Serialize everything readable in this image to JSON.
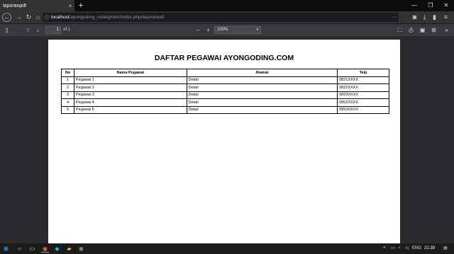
{
  "browser": {
    "tab_title": "laporanpdf",
    "tab_close": "×",
    "new_tab": "+",
    "window_controls": {
      "minimize": "—",
      "restore": "❐",
      "close": "✕"
    },
    "nav": {
      "back": "←",
      "forward": "→",
      "reload": "↻",
      "home": "⌂"
    },
    "url_host": "localhost",
    "url_path": "/ayongoding_codeigniter/index.php/laporanpdf",
    "url_info_icon": "ⓘ",
    "url_more": "···",
    "toolbar_right": {
      "pocket": "◙",
      "downloads": "⤓",
      "library": "▮",
      "menu": "≡"
    }
  },
  "pdf_toolbar": {
    "sidebar_icon": "▯",
    "prev_icon": "↑",
    "next_icon": "↓",
    "page_number": "1",
    "page_of": "of 1",
    "zoom_out": "−",
    "zoom_in": "+",
    "zoom_value": "100%",
    "zoom_caret": "▾",
    "presentation_icon": "⛶",
    "print_icon": "⎙",
    "save_icon": "▣",
    "bookmark_icon": "⊞",
    "more_icon": "»"
  },
  "document": {
    "title": "DAFTAR PEGAWAI AYONGODING.COM",
    "columns": {
      "no": "No",
      "nama": "Nama Pegawai",
      "alamat": "Alamat",
      "telp": "Telp"
    },
    "rows": [
      {
        "no": "1",
        "nama": "Pegawai 1",
        "alamat": "Detail",
        "telp": "0821XXXX"
      },
      {
        "no": "2",
        "nama": "Pegawai 2",
        "alamat": "Detail",
        "telp": "0822XXXX"
      },
      {
        "no": "3",
        "nama": "Pegawai 3",
        "alamat": "Detail",
        "telp": "0823XXXX"
      },
      {
        "no": "4",
        "nama": "Pegawai 4",
        "alamat": "Detail",
        "telp": "0852XXXX"
      },
      {
        "no": "5",
        "nama": "Pegawai 5",
        "alamat": "Detail",
        "telp": "0853XXXX"
      }
    ]
  },
  "taskbar": {
    "start": "⊞",
    "search": "○",
    "taskview": "▭",
    "apps": [
      "◉",
      "◆",
      "▰",
      "◼"
    ],
    "tray": {
      "chevron": "˄",
      "battery": "▭",
      "wifi": "◔",
      "volume": "◁",
      "lang": "ENG"
    },
    "time": "21:39",
    "notifications": "▤"
  },
  "colors": {
    "tab_bg": "#323234",
    "viewer_bg": "#2a2a2e",
    "page_bg": "#ffffff",
    "taskbar_bg": "#1b1b1b"
  }
}
